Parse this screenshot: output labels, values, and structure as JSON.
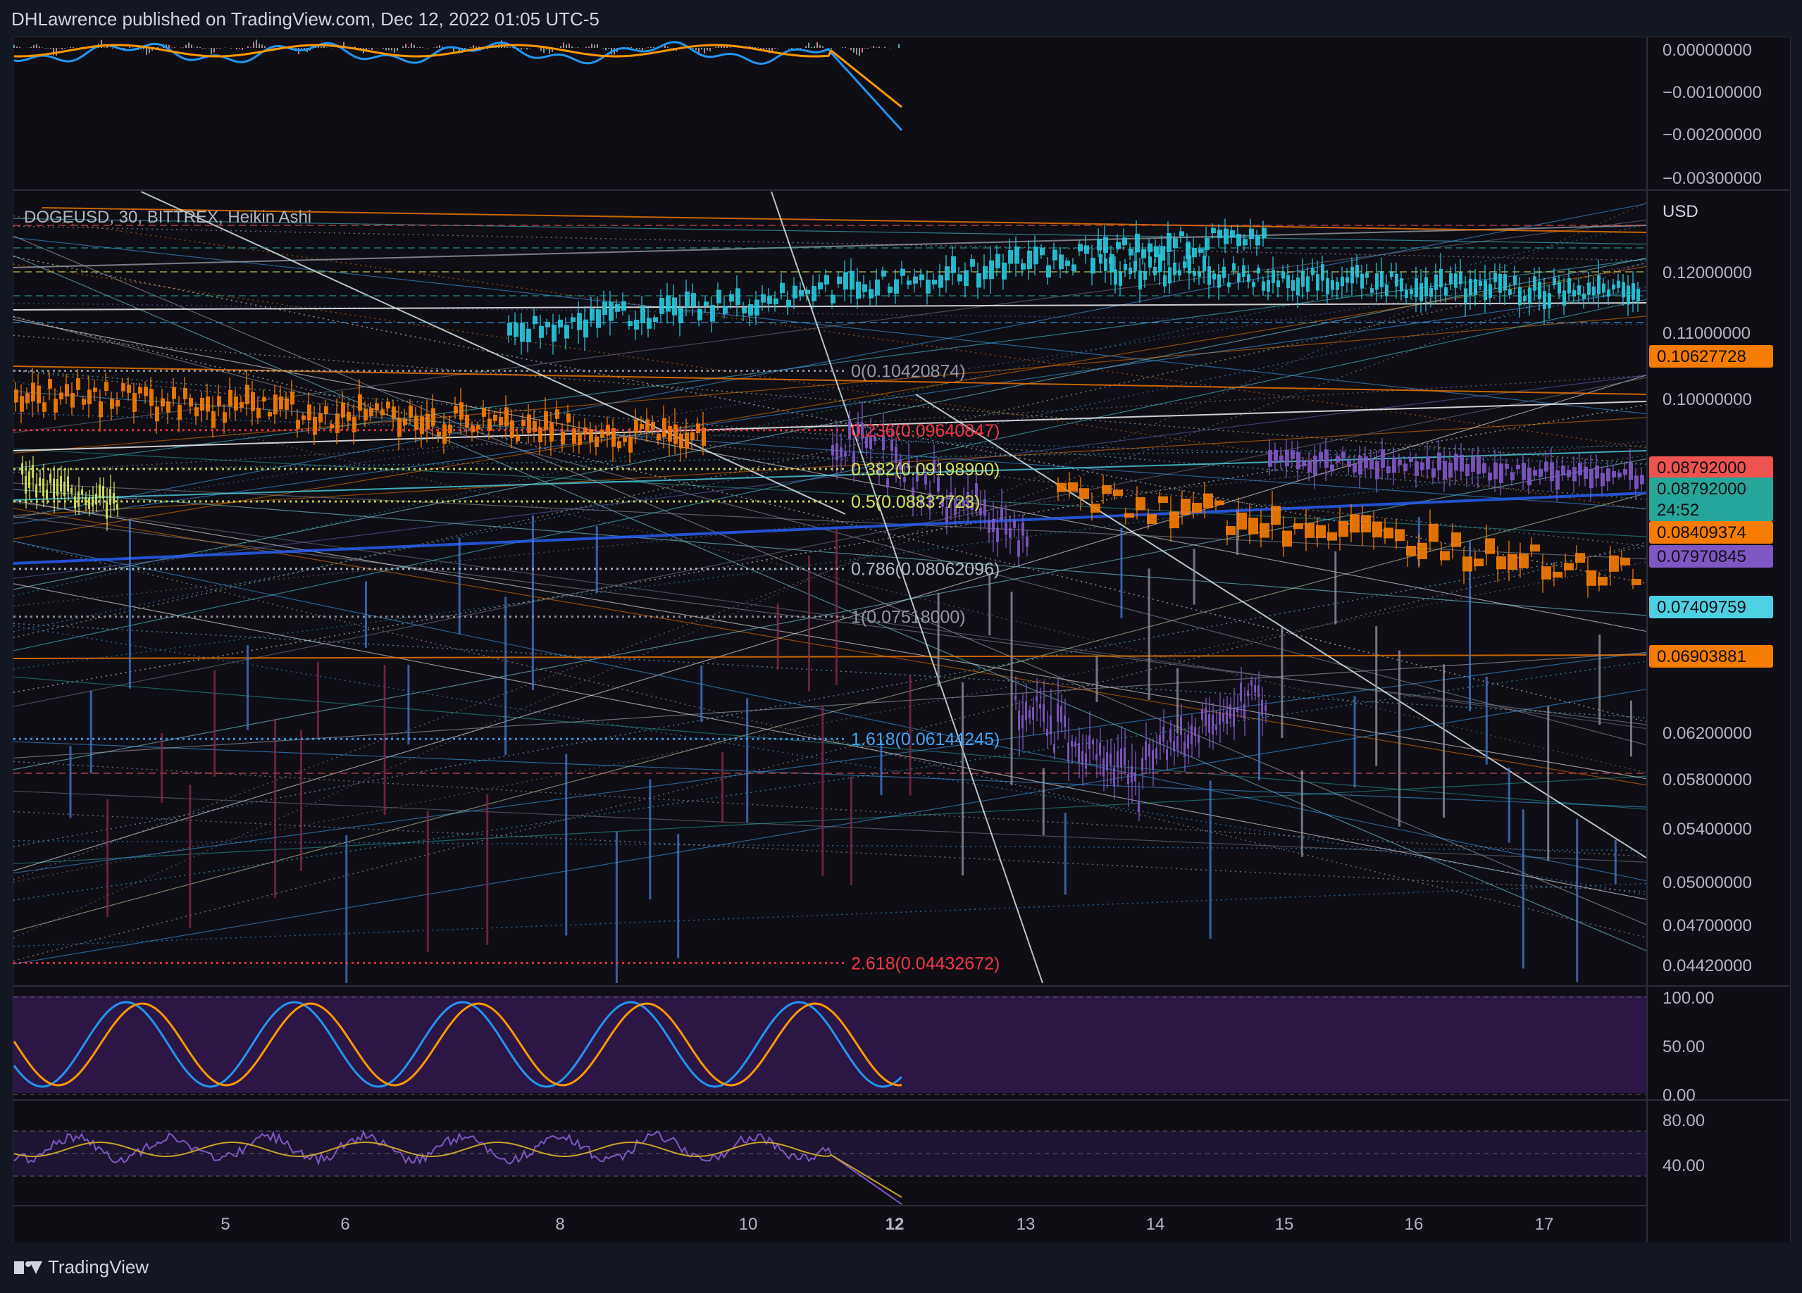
{
  "header": {
    "publisher_line": "DHLawrence published on TradingView.com, Dec 12, 2022 01:05 UTC-5"
  },
  "footer": {
    "brand": "TradingView"
  },
  "chart_data": {
    "type": "candlestick",
    "symbol_label": "DOGEUSD, 30, BITTREX, Heikin Ashi",
    "currency": "USD",
    "price_axis": {
      "ticks": [
        "0.12000000",
        "0.11000000",
        "0.10000000",
        "0.06200000",
        "0.05800000",
        "0.05400000",
        "0.05000000",
        "0.04700000",
        "0.04420000"
      ]
    },
    "price_badges": [
      {
        "label": "0.10627728",
        "color": "#f57c00",
        "value": 0.10627728
      },
      {
        "label": "0.08792000",
        "color": "#ef5350",
        "value": 0.08792
      },
      {
        "label": "0.08792000",
        "sublabel": "24:52",
        "color": "#26a69a",
        "value": 0.08792
      },
      {
        "label": "0.08409374",
        "color": "#f57c00",
        "value": 0.08409374
      },
      {
        "label": "0.07970845",
        "color": "#7e57c2",
        "value": 0.07970845
      },
      {
        "label": "0.07409759",
        "color": "#4dd0e1",
        "value": 0.07409759
      },
      {
        "label": "0.06903881",
        "color": "#f57c00",
        "value": 0.06903881
      }
    ],
    "fib_levels": [
      {
        "label": "0(0.10420874)",
        "color": "#9598a1",
        "value": 0.10420874
      },
      {
        "label": "0.236(0.09640847)",
        "color": "#f23645",
        "value": 0.09640847
      },
      {
        "label": "0.382(0.09198900)",
        "color": "#d4e157",
        "value": 0.091989
      },
      {
        "label": "0.5(0.0883?723)",
        "color": "#d4e157",
        "value": 0.0883
      },
      {
        "label": "0.786(0.08062096)",
        "color": "#b0bec5",
        "value": 0.08062096
      },
      {
        "label": "1(0.07518000)",
        "color": "#9598a1",
        "value": 0.07518
      },
      {
        "label": "1.618(0.06144245)",
        "color": "#42a5f5",
        "value": 0.06144245
      },
      {
        "label": "2.618(0.04432672)",
        "color": "#f23645",
        "value": 0.04432672
      }
    ],
    "x_axis": {
      "labels": [
        "5",
        "6",
        "8",
        "10",
        "12",
        "13",
        "14",
        "15",
        "16",
        "17"
      ],
      "highlighted": "12"
    },
    "macd_pane": {
      "ticks": [
        "0.00000000",
        "−0.00100000",
        "−0.00200000",
        "−0.00300000"
      ]
    },
    "stoch_pane": {
      "ticks": [
        "100.00",
        "50.00",
        "0.00"
      ]
    },
    "rsi_pane": {
      "ticks": [
        "80.00",
        "40.00"
      ]
    },
    "colors": {
      "background": "#0f0e15",
      "bull": "#26a69a",
      "bear": "#ef5350",
      "teal_candles": "#26c6da",
      "purple_candles": "#7e57c2",
      "orange_candles": "#f57c00",
      "blue_candles": "#4a7bd0"
    }
  }
}
